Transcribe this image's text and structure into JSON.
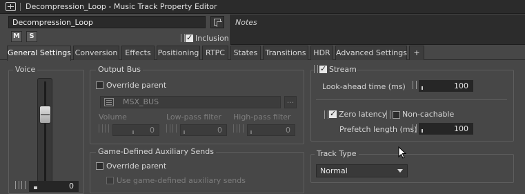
{
  "window": {
    "title": "Decompression_Loop - Music Track Property Editor"
  },
  "object": {
    "name": "Decompression_Loop",
    "notes_label": "Notes",
    "mute_label": "M",
    "solo_label": "S",
    "inclusion_label": "Inclusion",
    "inclusion_checked": true
  },
  "tabs": [
    {
      "label": "General Settings",
      "active": true
    },
    {
      "label": "Conversion"
    },
    {
      "label": "Effects"
    },
    {
      "label": "Positioning"
    },
    {
      "label": "RTPC"
    },
    {
      "label": "States"
    },
    {
      "label": "Transitions"
    },
    {
      "label": "HDR"
    },
    {
      "label": "Advanced Settings"
    },
    {
      "label": "+"
    }
  ],
  "voice": {
    "title": "Voice",
    "value": "0"
  },
  "output_bus": {
    "title": "Output Bus",
    "override_label": "Override parent",
    "override_checked": false,
    "bus_name": "MSX_BUS",
    "browse_label": "...",
    "volume_label": "Volume",
    "volume_value": "0",
    "lowpass_label": "Low-pass filter",
    "lowpass_value": "0",
    "highpass_label": "High-pass filter",
    "highpass_value": "0"
  },
  "aux_sends": {
    "title": "Game-Defined Auxiliary Sends",
    "override_label": "Override parent",
    "override_checked": false,
    "use_label": "Use game-defined auxiliary sends"
  },
  "stream": {
    "title": "Stream",
    "checked": true,
    "lookahead_label": "Look-ahead time (ms)",
    "lookahead_value": "100",
    "zero_latency_label": "Zero latency",
    "zero_latency_checked": true,
    "non_cachable_label": "Non-cachable",
    "non_cachable_checked": false,
    "prefetch_label": "Prefetch length (ms)",
    "prefetch_value": "100"
  },
  "track_type": {
    "title": "Track Type",
    "selected": "Normal"
  },
  "icons": {
    "window": "property-editor-icon",
    "name_action": "link-icon",
    "bus": "bus-icon",
    "dropdown": "chevron-down-icon",
    "cursor": "mouse-pointer-icon"
  }
}
